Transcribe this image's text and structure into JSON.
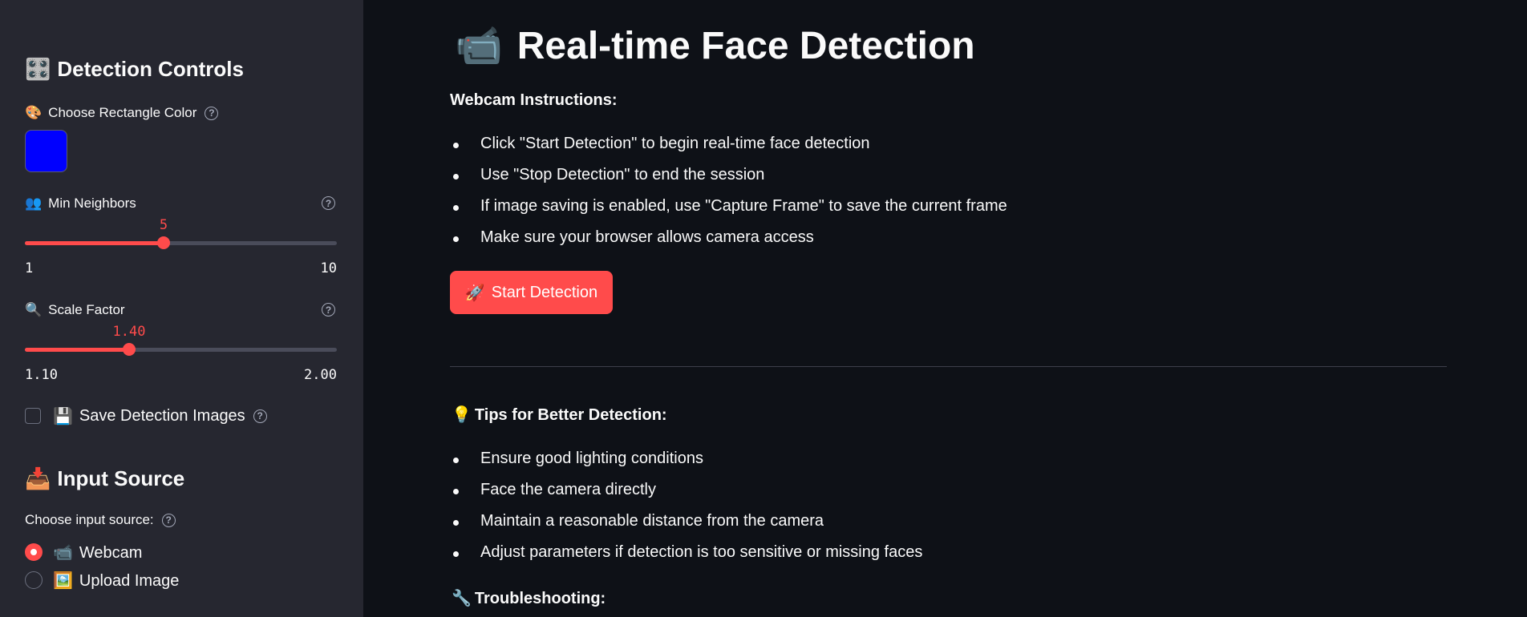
{
  "sidebar": {
    "detection_heading": "Detection Controls",
    "detection_icon": "🎛️",
    "color_label": "Choose Rectangle Color",
    "color_icon": "🎨",
    "color_value": "#0000ff",
    "min_neighbors": {
      "label": "Min Neighbors",
      "icon": "👥",
      "value": "5",
      "min": "1",
      "max": "10",
      "fraction": 0.444
    },
    "scale_factor": {
      "label": "Scale Factor",
      "icon": "🔍",
      "value": "1.40",
      "min": "1.10",
      "max": "2.00",
      "fraction": 0.333
    },
    "save_images": {
      "label": "Save Detection Images",
      "icon": "💾",
      "checked": false
    },
    "input_heading": "Input Source",
    "input_icon": "📥",
    "input_source_label": "Choose input source:",
    "options": [
      {
        "label": "Webcam",
        "icon": "📹",
        "selected": true
      },
      {
        "label": "Upload Image",
        "icon": "🖼️",
        "selected": false
      }
    ]
  },
  "main": {
    "title": "Real-time Face Detection",
    "title_icon": "📹",
    "webcam_heading": "Webcam Instructions:",
    "instructions": [
      "Click \"Start Detection\" to begin real-time face detection",
      "Use \"Stop Detection\" to end the session",
      "If image saving is enabled, use \"Capture Frame\" to save the current frame",
      "Make sure your browser allows camera access"
    ],
    "start_button": "Start Detection",
    "start_icon": "🚀",
    "tips_heading": "Tips for Better Detection:",
    "tips_icon": "💡",
    "tips": [
      "Ensure good lighting conditions",
      "Face the camera directly",
      "Maintain a reasonable distance from the camera",
      "Adjust parameters if detection is too sensitive or missing faces"
    ],
    "troubleshooting_heading": "Troubleshooting:",
    "troubleshooting_icon": "🔧"
  },
  "colors": {
    "accent": "#ff4b4b",
    "sidebar_bg": "#262730",
    "main_bg": "#0e1117"
  }
}
